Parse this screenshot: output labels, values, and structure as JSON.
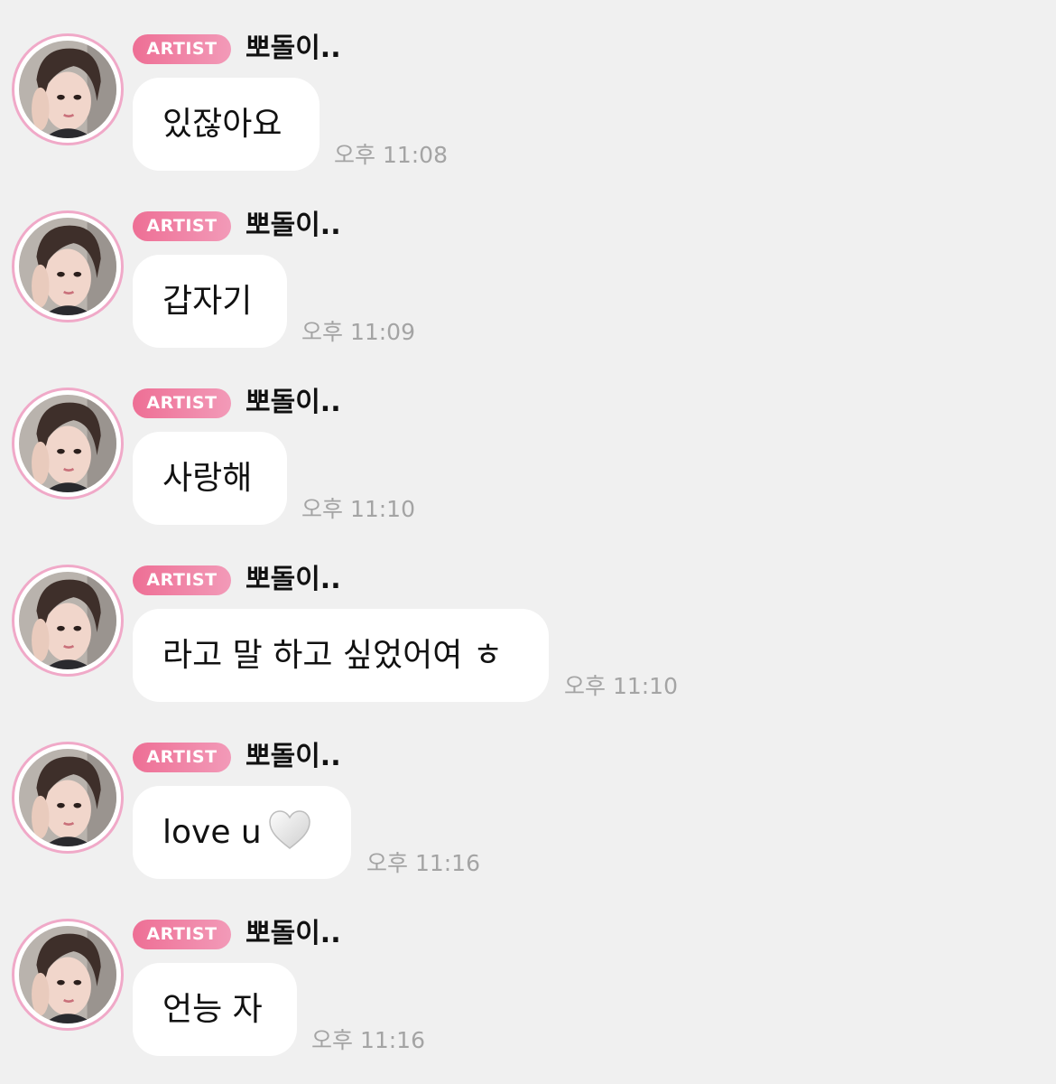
{
  "messages": [
    {
      "badge": "ARTIST",
      "sender": "뽀돌이..",
      "text": "있잖아요",
      "time": "오후 11:08"
    },
    {
      "badge": "ARTIST",
      "sender": "뽀돌이..",
      "text": "갑자기",
      "time": "오후 11:09"
    },
    {
      "badge": "ARTIST",
      "sender": "뽀돌이..",
      "text": "사랑해",
      "time": "오후 11:10"
    },
    {
      "badge": "ARTIST",
      "sender": "뽀돌이..",
      "text": "라고 말 하고 싶었어여 ㅎ",
      "time": "오후 11:10"
    },
    {
      "badge": "ARTIST",
      "sender": "뽀돌이..",
      "text": "love u",
      "emoji": "white-heart-icon",
      "time": "오후 11:16"
    },
    {
      "badge": "ARTIST",
      "sender": "뽀돌이..",
      "text": "언능 자",
      "time": "오후 11:16"
    }
  ],
  "colors": {
    "background": "#f0f0f0",
    "bubble": "#ffffff",
    "badge_start": "#ee6f95",
    "badge_end": "#f29ab8",
    "avatar_ring": "#f0a9c8",
    "timestamp": "#a4a4a4"
  }
}
